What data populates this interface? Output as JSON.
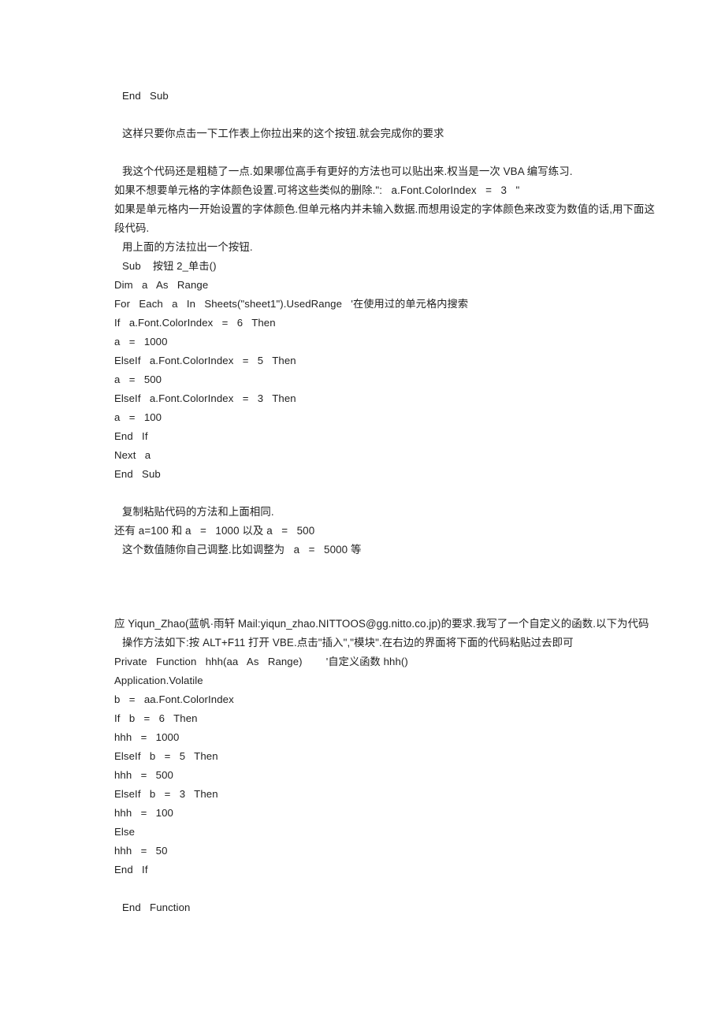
{
  "document": {
    "background_color": "#ffffff",
    "text_color": "#262626",
    "blocks": {
      "end_sub_top": "End   Sub",
      "para_click_button": "这样只要你点击一下工作表上你拉出来的这个按钮.就会完成你的要求",
      "para_rough_1": "我这个代码还是粗糙了一点.如果哪位高手有更好的方法也可以贴出来.权当是一次 VBA 编写练习.",
      "para_rough_2": "如果不想要单元格的字体颜色设置.可将这些类似的删除.\":   a.Font.ColorIndex   =   3   \"",
      "para_rough_3": "如果是单元格内一开始设置的字体颜色.但单元格内并未输入数据.而想用设定的字体颜色来改变为数值的话,用下面这段代码.",
      "para_make_button": "用上面的方法拉出一个按钮.",
      "code_block_1": {
        "l1": "Sub    按钮 2_单击()",
        "l2": "Dim   a   As   Range",
        "l3": "For   Each   a   In   Sheets(\"sheet1\").UsedRange   '在使用过的单元格内搜索",
        "l4": "If   a.Font.ColorIndex   =   6   Then",
        "l5": "a   =   1000",
        "l6": "ElseIf   a.Font.ColorIndex   =   5   Then",
        "l7": "a   =   500",
        "l8": "ElseIf   a.Font.ColorIndex   =   3   Then",
        "l9": "a   =   100",
        "l10": "End   If",
        "l11": "Next   a",
        "l12": "End   Sub"
      },
      "para_copy_paste": "复制粘贴代码的方法和上面相同.",
      "para_values": "还有 a=100 和 a   =   1000 以及 a   =   500",
      "para_adjust": "这个数值随你自己调整.比如调整为   a   =   5000 等",
      "para_request": "应 Yiqun_Zhao(蓝帆·雨轩    Mail:yiqun_zhao.NITTOOS@gg.nitto.co.jp)的要求.我写了一个自定义的函数.以下为代码",
      "para_howto": "操作方法如下:按 ALT+F11 打开 VBE.点击\"插入\",\"模块\".在右边的界面将下面的代码粘贴过去即可",
      "code_block_2": {
        "l1": "Private   Function   hhh(aa   As   Range)        '自定义函数 hhh()",
        "l2": "Application.Volatile",
        "l3": "b   =   aa.Font.ColorIndex",
        "l4": "If   b   =   6   Then",
        "l5": "hhh   =   1000",
        "l6": "ElseIf   b   =   5   Then",
        "l7": "hhh   =   500",
        "l8": "ElseIf   b   =   3   Then",
        "l9": "hhh   =   100",
        "l10": "Else",
        "l11": "hhh   =   50",
        "l12": "End   If",
        "l13": "End   Function"
      }
    }
  }
}
